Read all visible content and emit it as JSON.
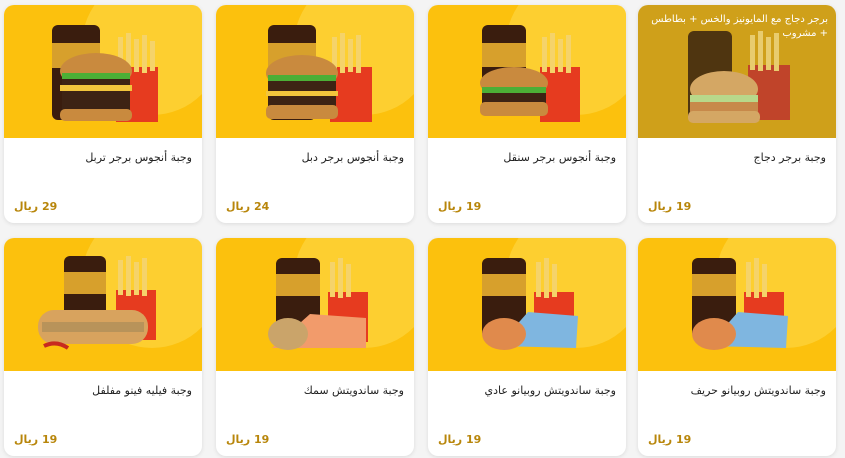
{
  "items": [
    {
      "name": "وجبة أنجوس برجر تربل",
      "price": "29 ريال",
      "kind": "burger-triple"
    },
    {
      "name": "وجبة أنجوس برجر دبل",
      "price": "24 ريال",
      "kind": "burger-double"
    },
    {
      "name": "وجبة أنجوس برجر سنقل",
      "price": "19 ريال",
      "kind": "burger-single"
    },
    {
      "name": "وجبة برجر دجاج",
      "price": "19 ريال",
      "kind": "chicken-burger",
      "overlay": "برجر دجاج مع المايونيز والخس + بطاطس + مشروب"
    },
    {
      "name": "وجبة فيليه فينو مفلفل",
      "price": "19 ريال",
      "kind": "fino"
    },
    {
      "name": "وجبة ساندويتش سمك",
      "price": "19 ريال",
      "kind": "fish-wrap"
    },
    {
      "name": "وجبة ساندويتش روبيانو عادي",
      "price": "19 ريال",
      "kind": "shrimp-wrap"
    },
    {
      "name": "وجبة ساندويتش روبيانو حريف",
      "price": "19 ريال",
      "kind": "shrimp-wrap"
    }
  ],
  "colors": {
    "photo_bg": "#fcc10d",
    "price": "#b8860b"
  }
}
